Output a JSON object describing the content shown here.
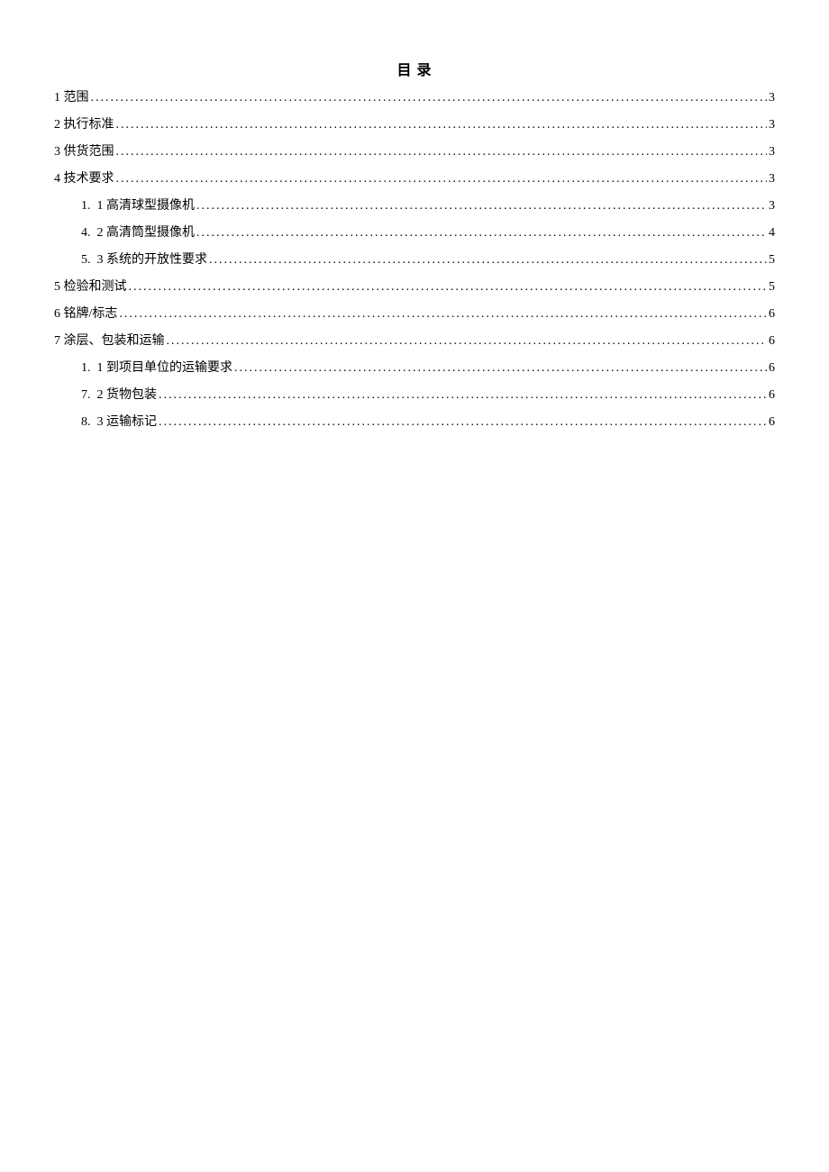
{
  "title": "目 录",
  "toc": [
    {
      "label": "1 范围",
      "page": "3",
      "indent": false
    },
    {
      "label": "2 执行标准",
      "page": "3",
      "indent": false
    },
    {
      "label": "3 供货范围",
      "page": "3",
      "indent": false
    },
    {
      "label": "4 技术要求",
      "page": "3",
      "indent": false
    },
    {
      "label": "1.  1 高清球型摄像机",
      "page": "3",
      "indent": true
    },
    {
      "label": "4.  2 高清筒型摄像机",
      "page": "4",
      "indent": true
    },
    {
      "label": "5.  3 系统的开放性要求",
      "page": "5",
      "indent": true
    },
    {
      "label": "5 检验和测试",
      "page": "5",
      "indent": false
    },
    {
      "label": "6 铭牌/标志",
      "page": "6",
      "indent": false
    },
    {
      "label": "7 涂层、包装和运输",
      "page": "6",
      "indent": false
    },
    {
      "label": "1.  1 到项目单位的运输要求",
      "page": "6",
      "indent": true
    },
    {
      "label": "7.  2 货物包装",
      "page": "6",
      "indent": true
    },
    {
      "label": "8.  3 运输标记",
      "page": "6",
      "indent": true
    }
  ]
}
